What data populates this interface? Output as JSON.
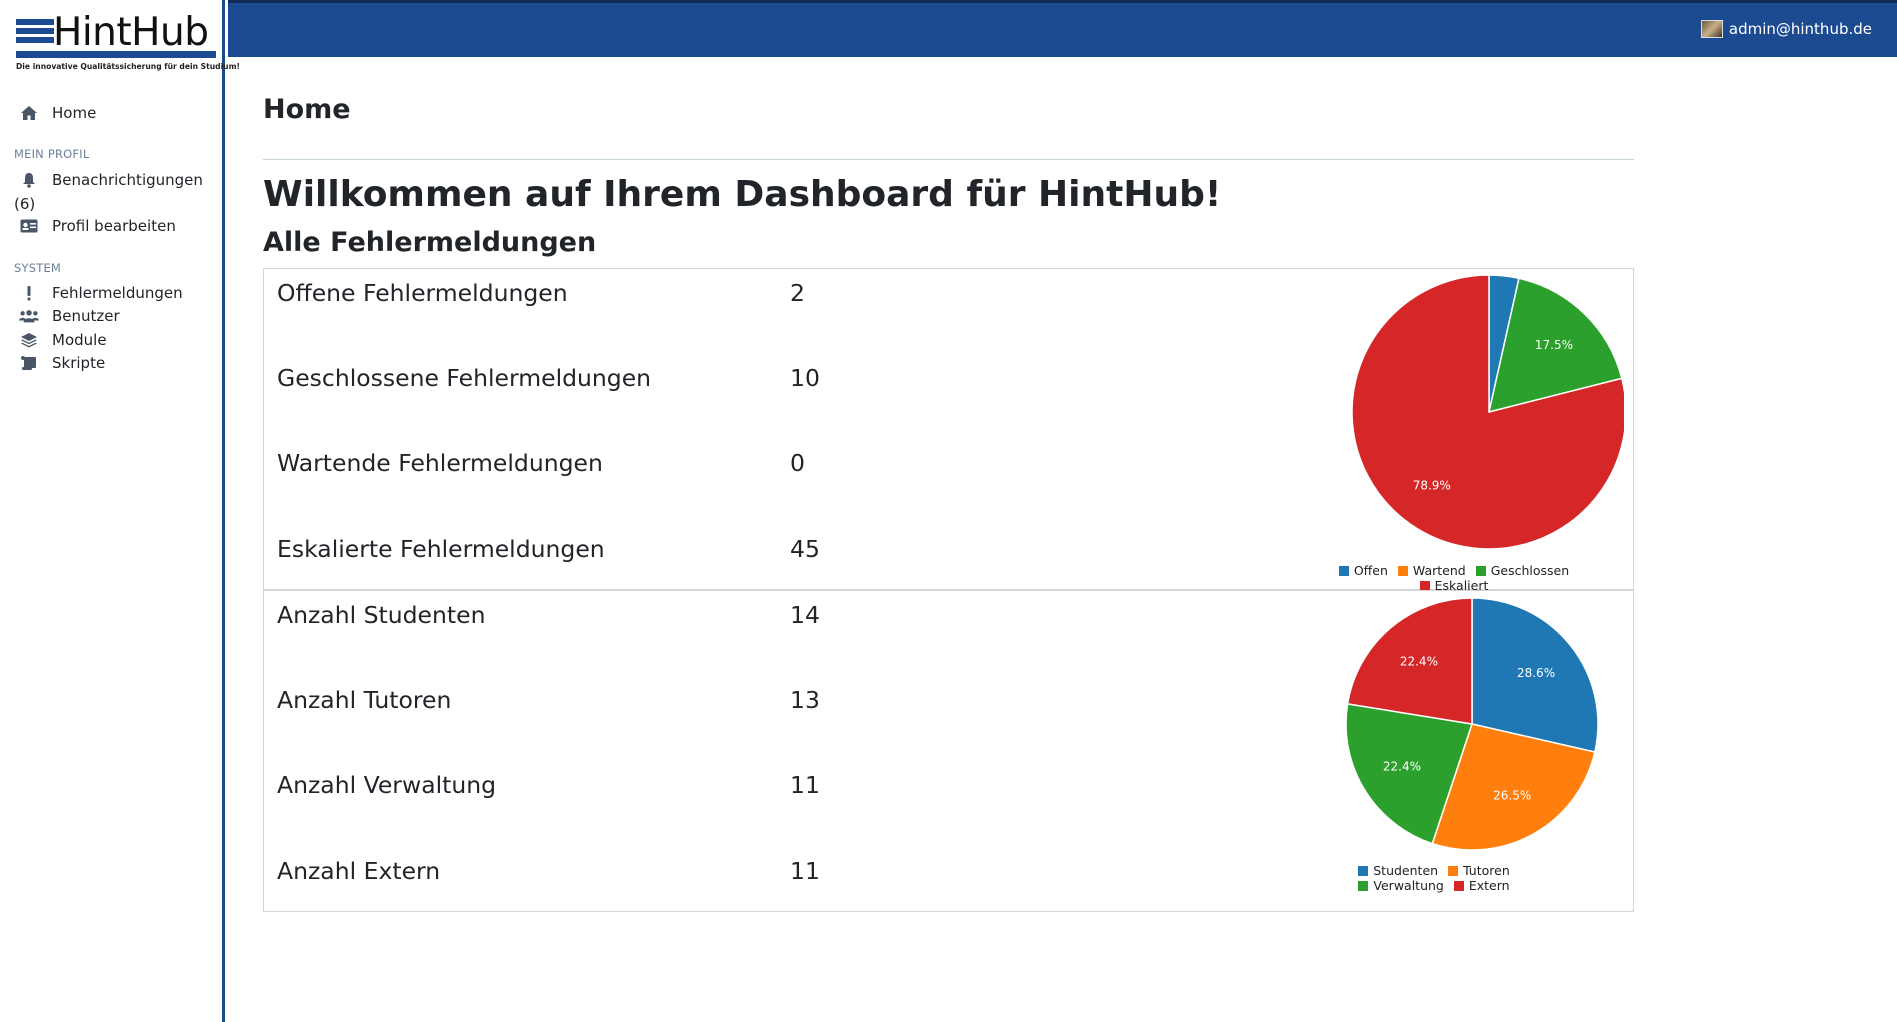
{
  "app": {
    "logo_text": "HintHub",
    "logo_tagline": "Die innovative Qualitätssicherung für dein Studium!"
  },
  "header": {
    "user_email": "admin@hinthub.de"
  },
  "sidebar": {
    "home_label": "Home",
    "section_profile": "MEIN PROFIL",
    "notifications_label": "Benachrichtigungen",
    "notifications_count": "(6)",
    "edit_profile_label": "Profil bearbeiten",
    "section_system": "SYSTEM",
    "items": [
      {
        "label": "Fehlermeldungen",
        "icon": "exclamation-icon"
      },
      {
        "label": "Benutzer",
        "icon": "users-icon"
      },
      {
        "label": "Module",
        "icon": "layers-icon"
      },
      {
        "label": "Skripte",
        "icon": "scroll-icon"
      }
    ]
  },
  "main": {
    "page_title": "Home",
    "welcome": "Willkommen auf Ihrem Dashboard für HintHub!",
    "subtitle": "Alle Fehlermeldungen",
    "reports": [
      {
        "label": "Offene Fehlermeldungen",
        "value": "2"
      },
      {
        "label": "Geschlossene Fehlermeldungen",
        "value": "10"
      },
      {
        "label": "Wartende Fehlermeldungen",
        "value": "0"
      },
      {
        "label": "Eskalierte Fehlermeldungen",
        "value": "45"
      }
    ],
    "users": [
      {
        "label": "Anzahl Studenten",
        "value": "14"
      },
      {
        "label": "Anzahl Tutoren",
        "value": "13"
      },
      {
        "label": "Anzahl Verwaltung",
        "value": "11"
      },
      {
        "label": "Anzahl Extern",
        "value": "11"
      }
    ]
  },
  "colors": {
    "blue": "#1f77b4",
    "orange": "#ff7f0e",
    "green": "#2ca02c",
    "red": "#d62728",
    "brand": "#1c4a91"
  },
  "chart_data": [
    {
      "type": "pie",
      "categories": [
        "Offen",
        "Wartend",
        "Geschlossen",
        "Eskaliert"
      ],
      "values": [
        2,
        0,
        10,
        45
      ],
      "labels": [
        "",
        "",
        "17.5%",
        "78.9%"
      ],
      "colors": [
        "#1f77b4",
        "#ff7f0e",
        "#2ca02c",
        "#d62728"
      ],
      "legend": "bottom"
    },
    {
      "type": "pie",
      "categories": [
        "Studenten",
        "Tutoren",
        "Verwaltung",
        "Extern"
      ],
      "values": [
        14,
        13,
        11,
        11
      ],
      "labels": [
        "28.6%",
        "26.5%",
        "22.4%",
        "22.4%"
      ],
      "colors": [
        "#1f77b4",
        "#ff7f0e",
        "#2ca02c",
        "#d62728"
      ],
      "legend": "bottom"
    }
  ]
}
